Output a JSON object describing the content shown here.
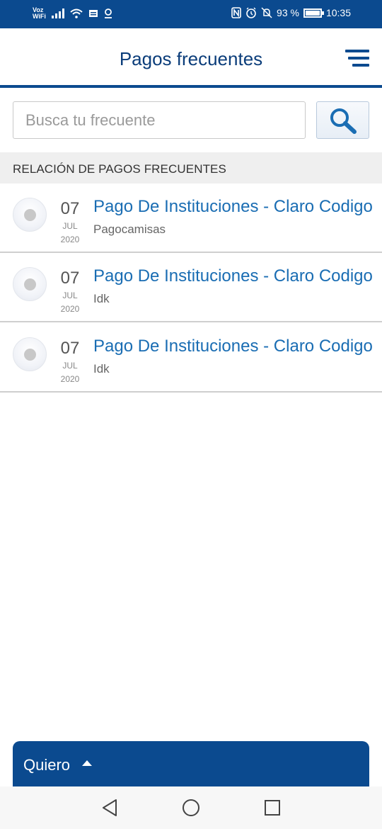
{
  "status_bar": {
    "voz_line1": "Voz",
    "voz_line2": "WiFi",
    "battery_text": "93 %",
    "battery_level": 0.93,
    "time": "10:35",
    "icons": [
      "signal-icon",
      "wifi-icon",
      "message-icon",
      "location-icon",
      "nfc-icon",
      "alarm-icon",
      "mute-icon",
      "battery-icon"
    ]
  },
  "header": {
    "title": "Pagos frecuentes",
    "menu_icon": "menu-icon"
  },
  "search": {
    "placeholder": "Busca tu frecuente",
    "value": "",
    "button_icon": "search-icon"
  },
  "section": {
    "title": "RELACIÓN DE PAGOS FRECUENTES"
  },
  "payments": [
    {
      "day": "07",
      "month": "JUL",
      "year": "2020",
      "title": "Pago De Instituciones - Claro Codigo",
      "subtitle": "Pagocamisas"
    },
    {
      "day": "07",
      "month": "JUL",
      "year": "2020",
      "title": "Pago De Instituciones - Claro Codigo",
      "subtitle": "Idk"
    },
    {
      "day": "07",
      "month": "JUL",
      "year": "2020",
      "title": "Pago De Instituciones - Claro Codigo",
      "subtitle": "Idk"
    }
  ],
  "quiero": {
    "label": "Quiero",
    "icon": "caret-up-icon"
  },
  "colors": {
    "brand": "#0b4a8f",
    "link": "#1a6db3",
    "section_bg": "#efefef"
  },
  "nav": {
    "icons": [
      "back-icon",
      "home-icon",
      "recents-icon"
    ]
  }
}
